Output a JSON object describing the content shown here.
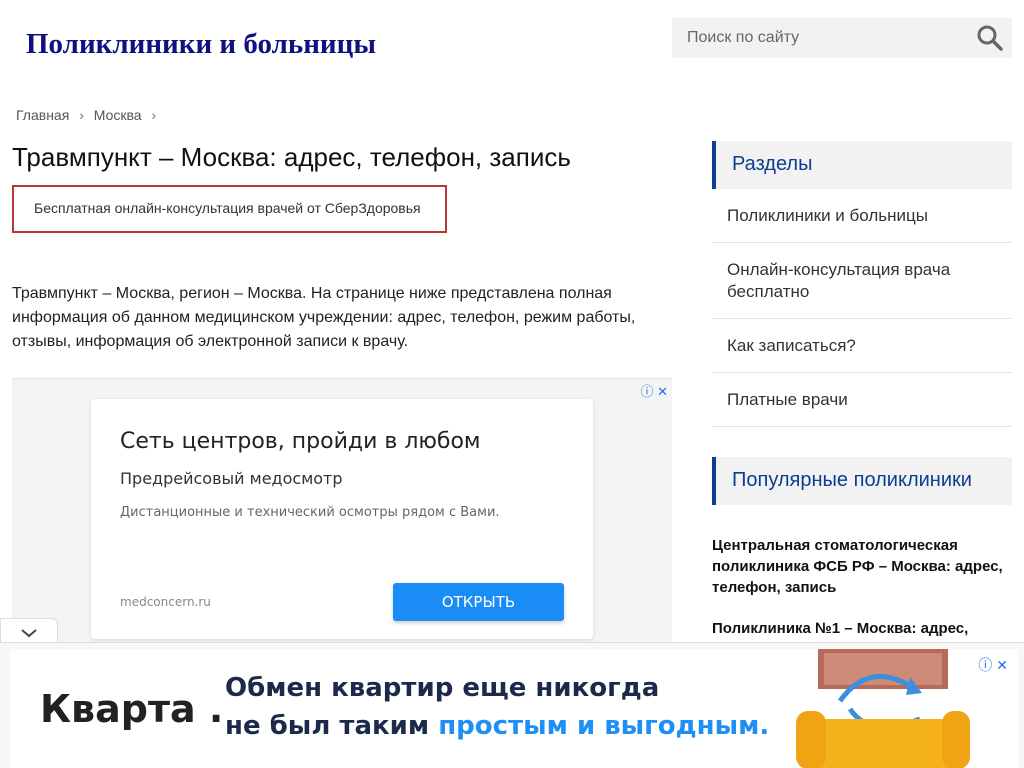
{
  "header": {
    "site_title": "Поликлиники и больницы",
    "search_placeholder": "Поиск по сайту"
  },
  "breadcrumb": [
    "Главная",
    "Москва"
  ],
  "main": {
    "title": "Травмпункт – Москва: адрес, телефон, запись",
    "consult_link": "Бесплатная онлайн-консультация врачей от СберЗдоровья",
    "intro": "Травмпункт – Москва, регион – Москва. На странице ниже представлена полная информация об данном медицинском учреждении: адрес, телефон, режим работы, отзывы, информация об электронной записи к врачу."
  },
  "ad": {
    "headline": "Сеть центров, пройди в любом",
    "subheadline": "Предрейсовый медосмотр",
    "description": "Дистанционные и технический осмотры рядом с Вами.",
    "domain": "medconcern.ru",
    "button": "ОТКРЫТЬ"
  },
  "sidebar": {
    "sections_title": "Разделы",
    "sections": [
      "Поликлиники и больницы",
      "Онлайн-консультация врача бесплатно",
      "Как записаться?",
      "Платные врачи"
    ],
    "popular_title": "Популярные поликлиники",
    "popular": [
      "Центральная стоматологическая поликлиника ФСБ РФ – Москва: адрес, телефон, запись",
      "Поликлиника №1 – Москва: адрес,"
    ]
  },
  "bottom_ad": {
    "brand": "Кварта",
    "line1": "Обмен квартир еще никогда",
    "line2_prefix": "не был таким",
    "line2_highlight": "простым и выгодным."
  },
  "colors": {
    "title_blue": "#101080",
    "accent_navy": "#0d3d8f",
    "consult_border": "#b83838",
    "ad_button": "#1a8cf5"
  }
}
